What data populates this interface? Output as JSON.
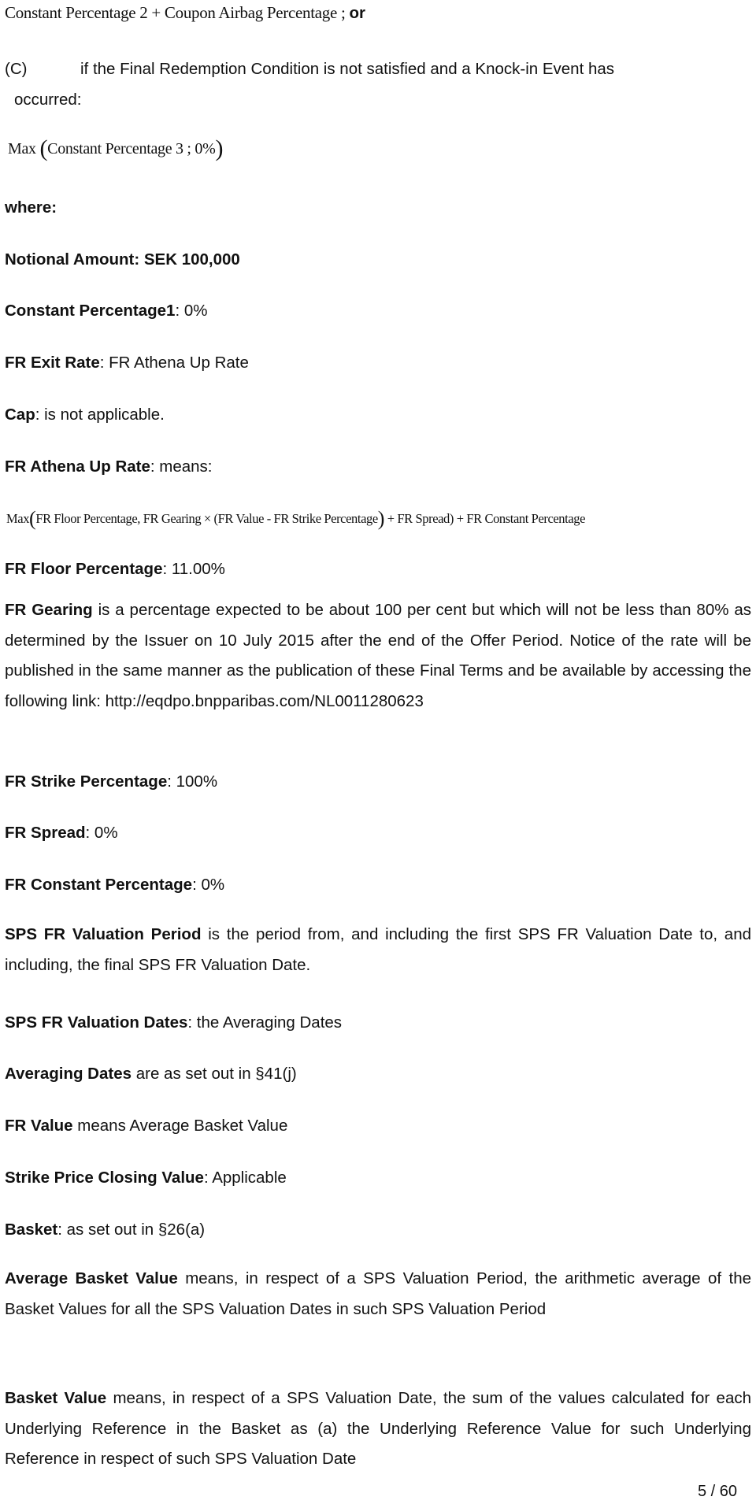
{
  "top_formula": {
    "text": "Constant Percentage 2 + Coupon Airbag Percentage ; ",
    "suffix": "or"
  },
  "clause_c": {
    "label": "(C)",
    "text_line1": "if the Final Redemption Condition is not satisfied and a Knock-in Event has",
    "text_line2": "occurred:"
  },
  "formula_c": {
    "max": "Max",
    "inner": "Constant Percentage 3 ; 0%"
  },
  "where_label": "where:",
  "definitions": [
    {
      "term": "Notional Amount: SEK 100,000",
      "value": ""
    },
    {
      "term": "Constant Percentage1",
      "value": ": 0%"
    },
    {
      "term": "FR Exit Rate",
      "value": ": FR Athena Up Rate"
    },
    {
      "term": "Cap",
      "value": ": is not applicable."
    },
    {
      "term": "FR Athena Up Rate",
      "value": ": means:"
    }
  ],
  "athena_formula": {
    "max": "Max",
    "part1": "FR Floor Percentage, FR Gearing × (FR Value - FR Strike Percentage",
    "part2": " + FR  Spread) + FR Constant Percentage"
  },
  "floor_percentage": {
    "term": "FR Floor Percentage",
    "value": ": 11.00%"
  },
  "gearing": {
    "term": "FR Gearing",
    "text": " is a percentage expected to be about 100 per cent but which will not be less than 80% as determined by the Issuer on  10 July 2015 after the end of the Offer Period. Notice of the rate will be published in the same manner as the publication of these Final Terms and be available by accessing the following link: http://eqdpo.bnpparibas.com/NL0011280623"
  },
  "definitions2": [
    {
      "term": "FR Strike Percentage",
      "value": ": 100%"
    },
    {
      "term": "FR Spread",
      "value": ": 0%"
    },
    {
      "term": "FR Constant Percentage",
      "value": ": 0%"
    }
  ],
  "valuation_period": {
    "term": "SPS FR Valuation Period",
    "text": " is the period from, and including the first SPS FR Valuation Date to, and including, the final SPS FR Valuation Date."
  },
  "definitions3": [
    {
      "term": "SPS FR Valuation Dates",
      "value": ": the Averaging Dates"
    },
    {
      "term": "Averaging Dates",
      "value": " are as set out in §41(j)"
    },
    {
      "term": "FR Value",
      "value": " means Average Basket Value"
    },
    {
      "term": "Strike Price Closing Value",
      "value": ": Applicable"
    },
    {
      "term": "Basket",
      "value": ": as set out in §26(a)"
    }
  ],
  "average_basket_value": {
    "term": "Average Basket Value",
    "text": " means, in respect of a SPS Valuation Period, the arithmetic average of the Basket Values for all the SPS Valuation Dates in such SPS Valuation Period"
  },
  "basket_value": {
    "term": "Basket Value",
    "text": " means, in respect of a SPS Valuation Date, the sum of the values calculated for each Underlying Reference in the Basket as (a) the Underlying Reference Value for such Underlying Reference in respect of such SPS Valuation Date"
  },
  "page_number": "5 / 60"
}
